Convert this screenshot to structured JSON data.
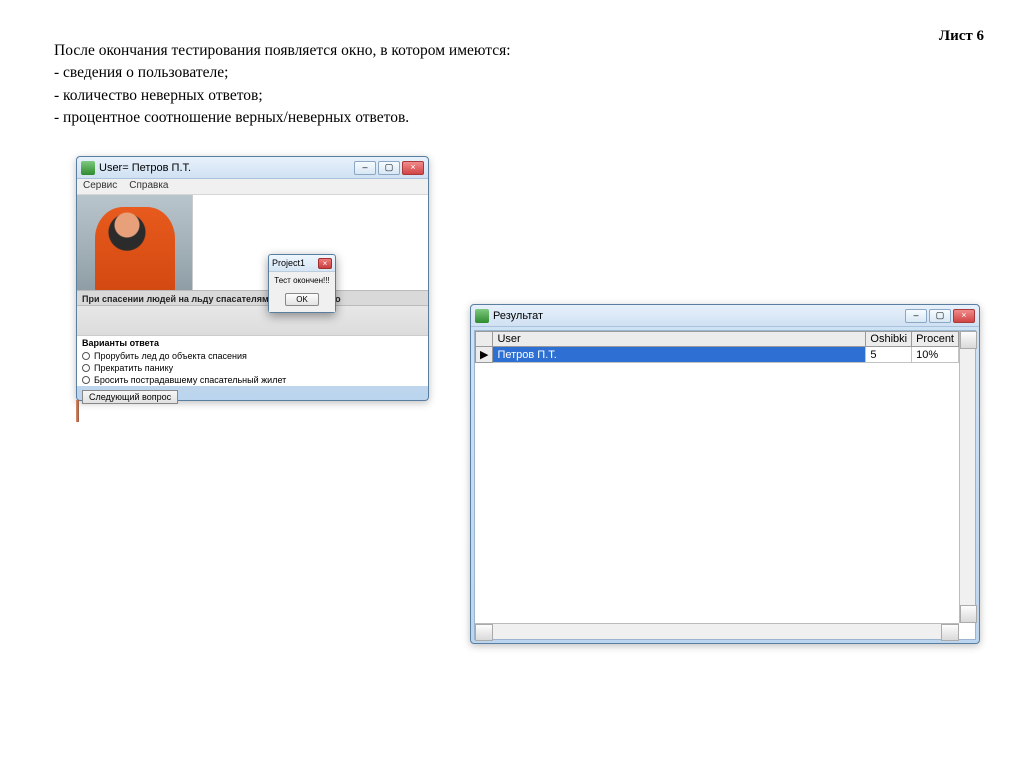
{
  "page": {
    "sheet_label": "Лист 6",
    "intro": "После окончания тестирования появляется окно, в котором имеются:",
    "bullet1": "- сведения о пользователе;",
    "bullet2": "- количество неверных ответов;",
    "bullet3": "- процентное соотношение верных/неверных ответов."
  },
  "left_window": {
    "title": "User= Петров П.Т.",
    "menu1": "Сервис",
    "menu2": "Справка",
    "question": "При спасении людей на льду спасателям первоначально",
    "answers_head": "Варианты ответа",
    "a1": "Прорубить лед до объекта спасения",
    "a2": "Прекратить панику",
    "a3": "Бросить пострадавшему спасательный жилет",
    "next_button": "Следующий вопрос"
  },
  "dialog": {
    "title": "Project1",
    "message": "Тест окончен!!!",
    "ok": "OK"
  },
  "right_window": {
    "title": "Результат",
    "columns": {
      "user": "User",
      "errors": "Oshibki",
      "percent": "Procent"
    },
    "rows": [
      {
        "user": "Петров П.Т.",
        "errors": "5",
        "percent": "10%"
      }
    ]
  }
}
